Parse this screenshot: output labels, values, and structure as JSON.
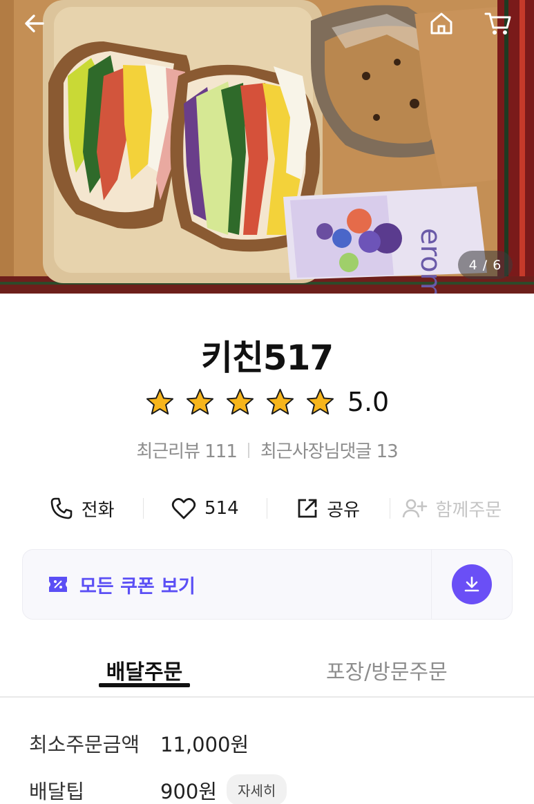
{
  "gallery": {
    "counter": "4 / 6"
  },
  "icons": {
    "back": "arrow-left-icon",
    "home": "home-icon",
    "cart": "cart-icon"
  },
  "store": {
    "name": "키친517",
    "rating": "5.0",
    "rating_value": 5,
    "rating_max": 5,
    "recent_reviews": "최근리뷰 111",
    "recent_owner_comments": "최근사장님댓글 13"
  },
  "actions": {
    "call": "전화",
    "likes": "514",
    "share": "공유",
    "group_order": "함께주문"
  },
  "coupon": {
    "label": "모든 쿠폰 보기"
  },
  "tabs": [
    {
      "label": "배달주문",
      "active": true
    },
    {
      "label": "포장/방문주문",
      "active": false
    }
  ],
  "info": {
    "min_order_label": "최소주문금액",
    "min_order_value": "11,000원",
    "delivery_tip_label": "배달팁",
    "delivery_tip_value": "900원",
    "detail_label": "자세히"
  },
  "colors": {
    "accent": "#6a4ff6",
    "coupon_text": "#5b4ff5",
    "star": "#f7b51b",
    "muted": "#8d8d8d"
  }
}
